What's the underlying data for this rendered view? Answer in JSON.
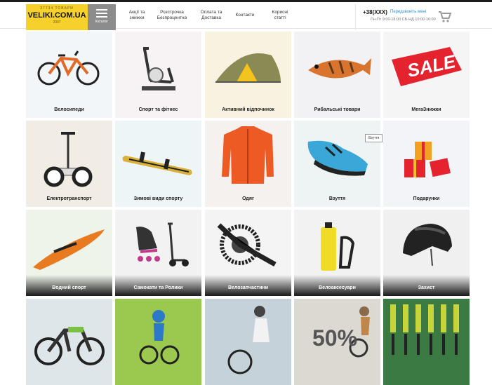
{
  "header": {
    "logo_top": "37734 ТОВАРИ",
    "logo_main": "VELIKI.COM.UA",
    "logo_year": "2007",
    "catalog_label": "Каталог",
    "nav": [
      {
        "line1": "Акції та",
        "line2": "знижки"
      },
      {
        "line1": "Розстрочка",
        "line2": "Безпроцентна"
      },
      {
        "line1": "Оплата та",
        "line2": "Доставка"
      },
      {
        "line1": "Контакти",
        "line2": ""
      },
      {
        "line1": "Корисні",
        "line2": "статті"
      }
    ],
    "phone": "+38(XXX)",
    "callback": "Передзвоніть мені",
    "hours": "Пн-Пт 9:00-18:00 СБ-НД 10:00-16:00"
  },
  "categories": [
    {
      "label": "Велосипеди"
    },
    {
      "label": "Спорт та фітнес"
    },
    {
      "label": "Активний відпочинок"
    },
    {
      "label": "Рибальські товари"
    },
    {
      "label": "МегаЗнижки",
      "sale_text": "SALE"
    },
    {
      "label": "Електротранспорт"
    },
    {
      "label": "Зимові види спорту"
    },
    {
      "label": "Одяг"
    },
    {
      "label": "Взуття"
    },
    {
      "label": "Подарунки"
    },
    {
      "label": "Водний спорт"
    },
    {
      "label": "Самокати та Ролики"
    },
    {
      "label": "Велозапчастини"
    },
    {
      "label": "Велоаксесуари"
    },
    {
      "label": "Захист"
    },
    {
      "label": ""
    },
    {
      "label": ""
    },
    {
      "label": ""
    },
    {
      "label": "",
      "promo_text": "50%"
    },
    {
      "label": ""
    }
  ],
  "tooltip": "Взуття",
  "colors": {
    "accent": "#f6d12b",
    "link": "#2c8fd4",
    "catalog_bg": "#8c8c8c"
  }
}
